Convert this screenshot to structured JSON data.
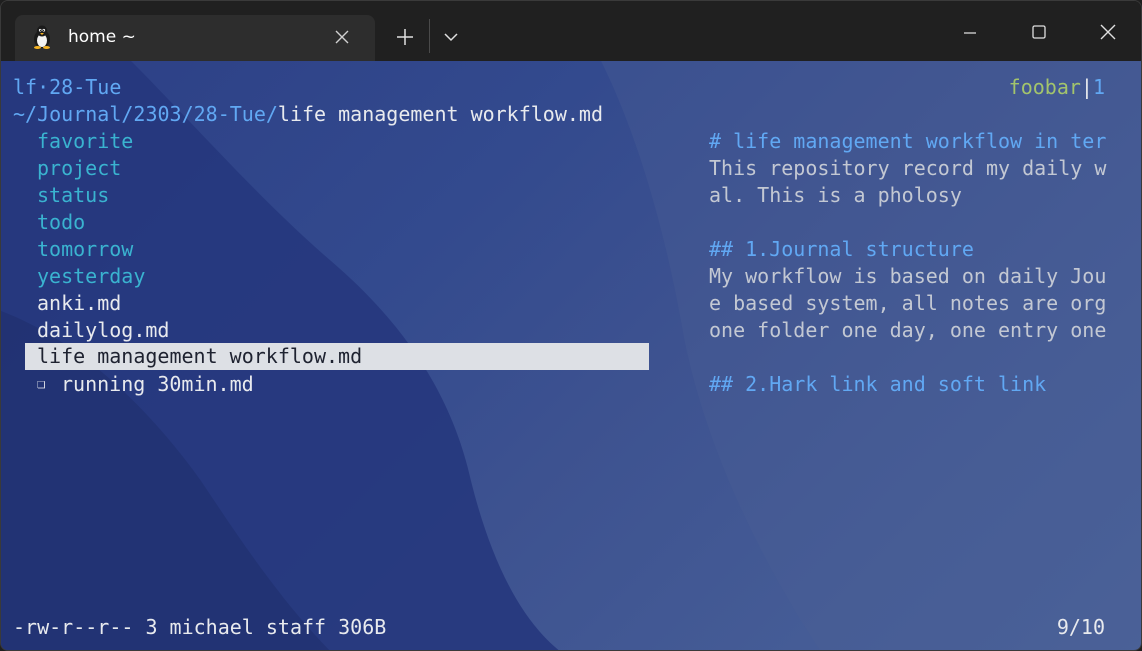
{
  "tab": {
    "title": "home ~",
    "icon": "linux-penguin-icon"
  },
  "header": {
    "left": "lf·28-Tue",
    "path_dir": "~/Journal/2303/28-Tue/",
    "path_file": "life management workflow.md",
    "host": "foobar",
    "divider": "|",
    "pane": "1"
  },
  "files": [
    {
      "name": "favorite",
      "type": "dir"
    },
    {
      "name": "project",
      "type": "dir"
    },
    {
      "name": "status",
      "type": "dir"
    },
    {
      "name": "todo",
      "type": "dir"
    },
    {
      "name": "tomorrow",
      "type": "dir"
    },
    {
      "name": "yesterday",
      "type": "dir"
    },
    {
      "name": "anki.md",
      "type": "file"
    },
    {
      "name": "dailylog.md",
      "type": "file"
    },
    {
      "name": "life management workflow.md",
      "type": "file",
      "selected": true
    },
    {
      "name": "running 30min.md",
      "type": "file",
      "marker": "❏"
    }
  ],
  "preview": [
    {
      "text": "# life management workflow in ter",
      "style": "heading"
    },
    {
      "text": "This repository record my daily w",
      "style": "body"
    },
    {
      "text": "al. This is a pholosy",
      "style": "body"
    },
    {
      "text": "",
      "style": "body"
    },
    {
      "text": "## 1.Journal structure",
      "style": "heading"
    },
    {
      "text": "My workflow is based on daily Jou",
      "style": "body"
    },
    {
      "text": "e based system, all notes are org",
      "style": "body"
    },
    {
      "text": "one folder one day, one entry one",
      "style": "body"
    },
    {
      "text": "",
      "style": "body"
    },
    {
      "text": "## 2.Hark link and soft link",
      "style": "heading"
    }
  ],
  "status": {
    "info": "-rw-r--r-- 3 michael staff 306B",
    "position": "9/10"
  },
  "colors": {
    "dir": "#3ab3d0",
    "file": "#e8eaee",
    "heading": "#61a8f3",
    "body": "#c3c8d3",
    "host": "#a3c46c",
    "selection": "#dde0e5"
  }
}
